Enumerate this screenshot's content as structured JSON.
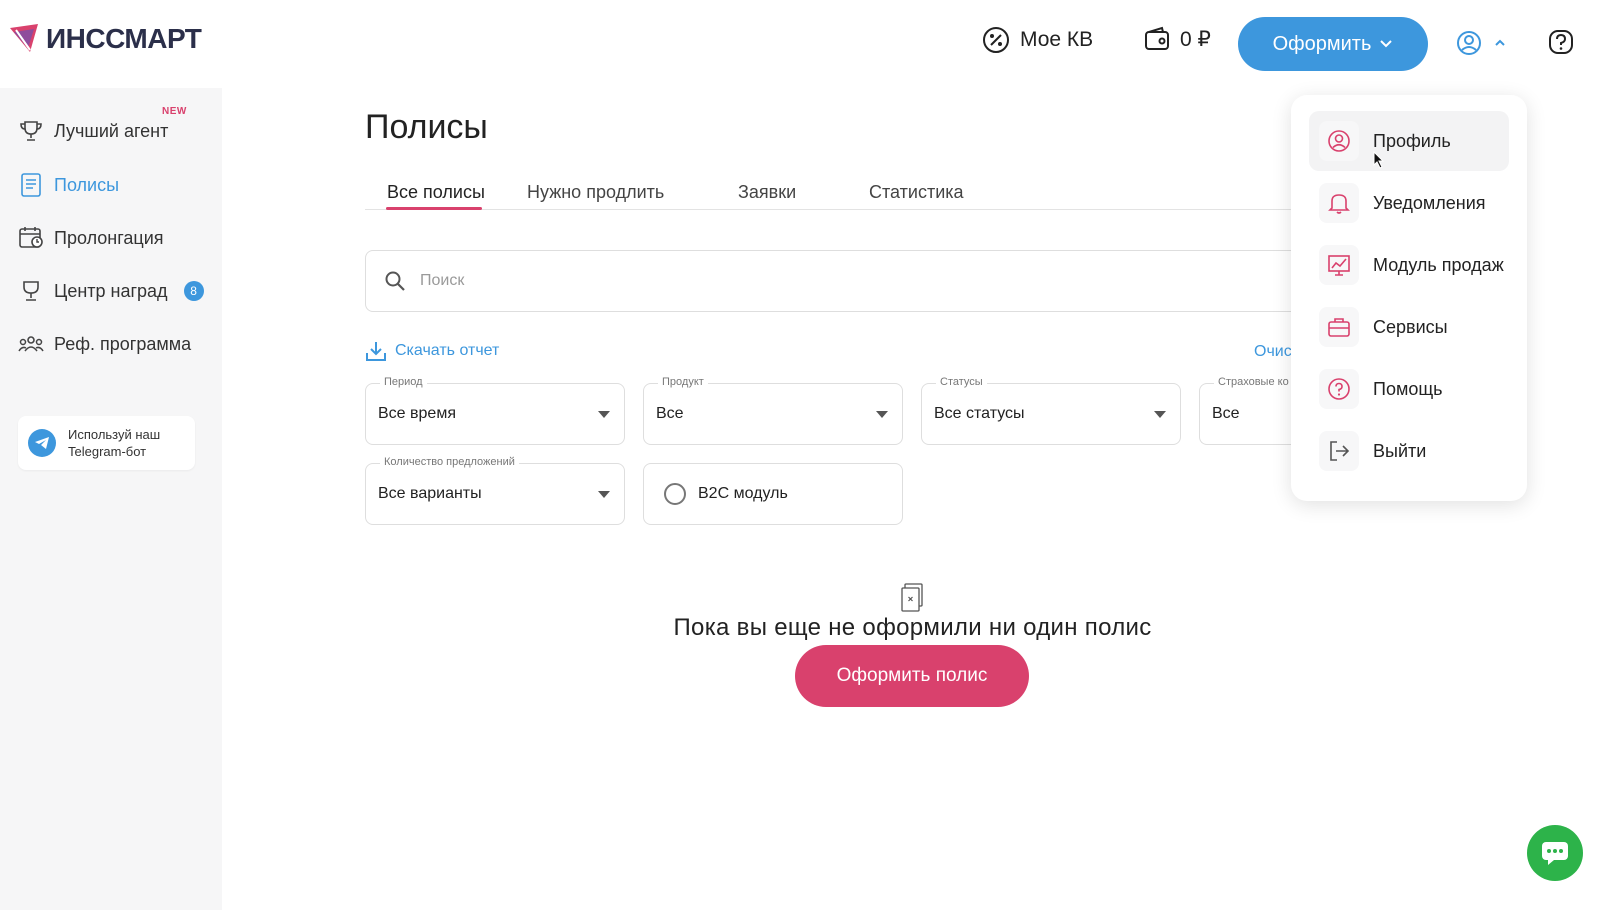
{
  "brand": {
    "name": "ИНССМАРТ"
  },
  "header": {
    "kv_label": "Мое КВ",
    "balance": "0 ₽",
    "order_button": "Оформить"
  },
  "sidebar": {
    "items": [
      {
        "label": "Лучший агент",
        "icon": "trophy-icon",
        "badge": "NEW"
      },
      {
        "label": "Полисы",
        "icon": "document-icon",
        "active": true
      },
      {
        "label": "Пролонгация",
        "icon": "calendar-icon"
      },
      {
        "label": "Центр наград",
        "icon": "award-icon",
        "count": "8"
      },
      {
        "label": "Реф. программа",
        "icon": "people-icon"
      }
    ],
    "telegram": {
      "line1": "Используй наш",
      "line2": "Telegram-бот"
    }
  },
  "main": {
    "title": "Полисы",
    "tabs": [
      "Все полисы",
      "Нужно продлить",
      "Заявки",
      "Статистика"
    ],
    "search_placeholder": "Поиск",
    "download_label": "Скачать отчет",
    "clear_label": "Очис",
    "filters": {
      "period": {
        "label": "Период",
        "value": "Все время"
      },
      "product": {
        "label": "Продукт",
        "value": "Все"
      },
      "status": {
        "label": "Статусы",
        "value": "Все статусы"
      },
      "insurer": {
        "label": "Страховые ко",
        "value": "Все"
      },
      "offers": {
        "label": "Количество предложений",
        "value": "Все варианты"
      },
      "b2c": {
        "label": "B2C модуль"
      }
    },
    "empty_text": "Пока вы еще не оформили ни один полис",
    "cta_label": "Оформить полис"
  },
  "user_menu": {
    "items": [
      {
        "label": "Профиль",
        "icon": "profile-icon"
      },
      {
        "label": "Уведомления",
        "icon": "bell-icon"
      },
      {
        "label": "Модуль продаж",
        "icon": "sales-chart-icon"
      },
      {
        "label": "Сервисы",
        "icon": "briefcase-icon"
      },
      {
        "label": "Помощь",
        "icon": "question-icon"
      },
      {
        "label": "Выйти",
        "icon": "logout-icon"
      }
    ]
  },
  "colors": {
    "accent_blue": "#3d97dd",
    "accent_pink": "#d9416d",
    "chat_green": "#2db34a"
  }
}
